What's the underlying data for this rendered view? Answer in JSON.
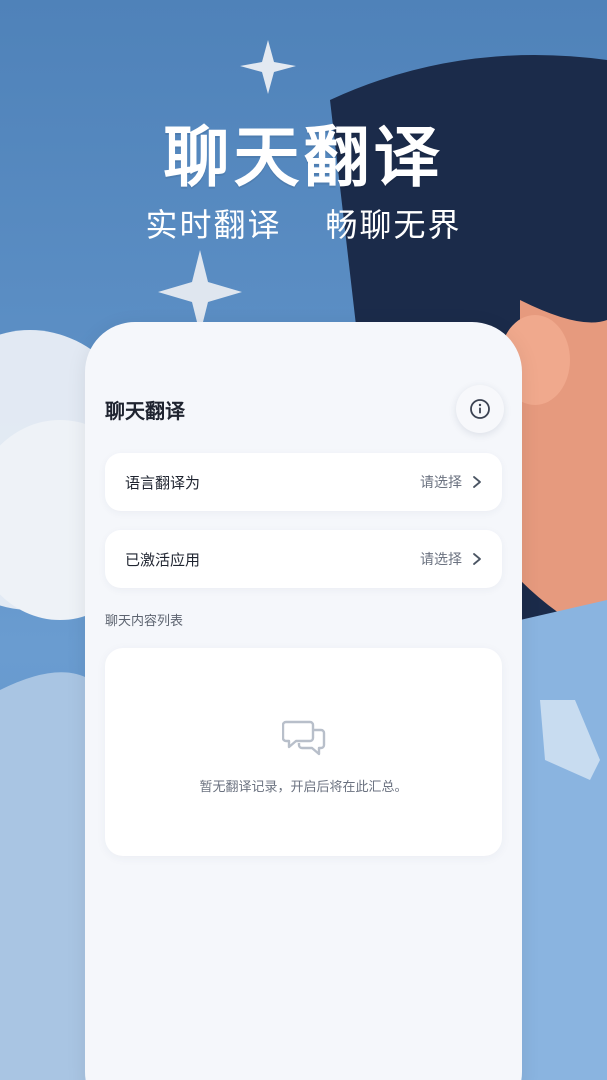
{
  "hero": {
    "title": "聊天翻译",
    "subtitle_left": "实时翻译",
    "subtitle_right": "畅聊无界"
  },
  "page": {
    "title": "聊天翻译",
    "info_icon": "info-icon"
  },
  "rows": [
    {
      "label": "语言翻译为",
      "value": "请选择",
      "icon": "chevron-right-icon"
    },
    {
      "label": "已激活应用",
      "value": "请选择",
      "icon": "chevron-right-icon"
    }
  ],
  "list": {
    "section_label": "聊天内容列表",
    "empty_icon": "chat-bubbles-icon",
    "empty_text": "暂无翻译记录，开启后将在此汇总。"
  },
  "colors": {
    "background": "#5b8ec4",
    "panel": "#f5f7fb",
    "text_primary": "#1f2430",
    "text_secondary": "#6b7280"
  }
}
